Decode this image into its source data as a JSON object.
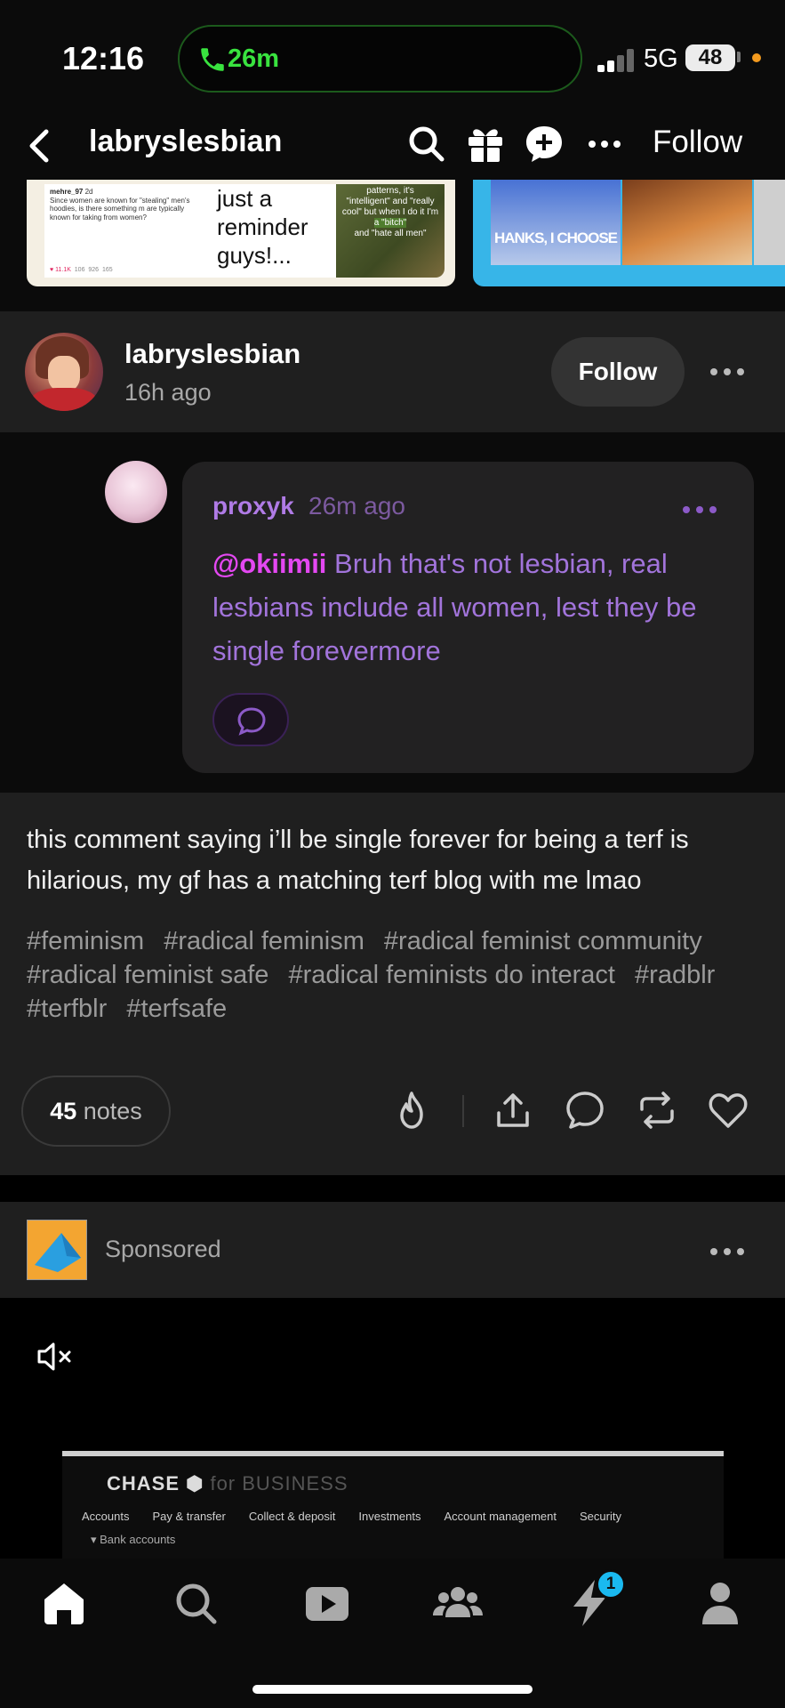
{
  "status_bar": {
    "time": "12:16",
    "call_duration": "26m",
    "network": "5G",
    "battery": "48"
  },
  "header": {
    "title": "labryslesbian",
    "follow_label": "Follow"
  },
  "carousel": {
    "card1": {
      "tweet_user": "mehre_97",
      "tweet_age": "2d",
      "tweet_text": "Since women are known for \"stealing\" men's hoodies, is there something m are typically known for taking from women?",
      "tweet_stats": [
        "11.1K",
        "106",
        "926",
        "165"
      ],
      "caption_text": "just a reminder guys!...",
      "image_text_top": "patterns, it's",
      "image_text_mid": "\"intelligent\" and \"really cool\" but when I do it I'm",
      "image_text_hl": "a \"bitch\"",
      "image_text_end": "and \"hate all men\""
    },
    "card2": {
      "image_label": "HANKS, I CHOOSE"
    }
  },
  "post": {
    "blog": "labryslesbian",
    "time": "16h ago",
    "follow_label": "Follow",
    "comment": {
      "user": "proxyk",
      "time": "26m ago",
      "mention": "@okiimii",
      "text": "Bruh that's not lesbian, real lesbians include all women, lest they be single forevermore"
    },
    "body": "this comment saying i’ll be single forever for being a terf is hilarious, my gf has a matching terf blog with me lmao",
    "tags": [
      "#feminism",
      "#radical feminism",
      "#radical feminist community",
      "#radical feminist safe",
      "#radical feminists do interact",
      "#radblr",
      "#terfblr",
      "#terfsafe"
    ],
    "notes_count": "45",
    "notes_label": "notes"
  },
  "sponsored": {
    "label": "Sponsored",
    "ad_brand": "CHASE",
    "ad_brand_suffix": "for BUSINESS",
    "ad_nav": [
      "Accounts",
      "Pay & transfer",
      "Collect & deposit",
      "Investments",
      "Account management",
      "Security"
    ],
    "ad_sub": "▾ Bank accounts"
  },
  "tab_bar": {
    "activity_badge": "1"
  },
  "colors": {
    "accent_purple": "#a274db",
    "mention_pink": "#e448f2",
    "badge_blue": "#1ab9f0",
    "call_green": "#39e33f"
  }
}
